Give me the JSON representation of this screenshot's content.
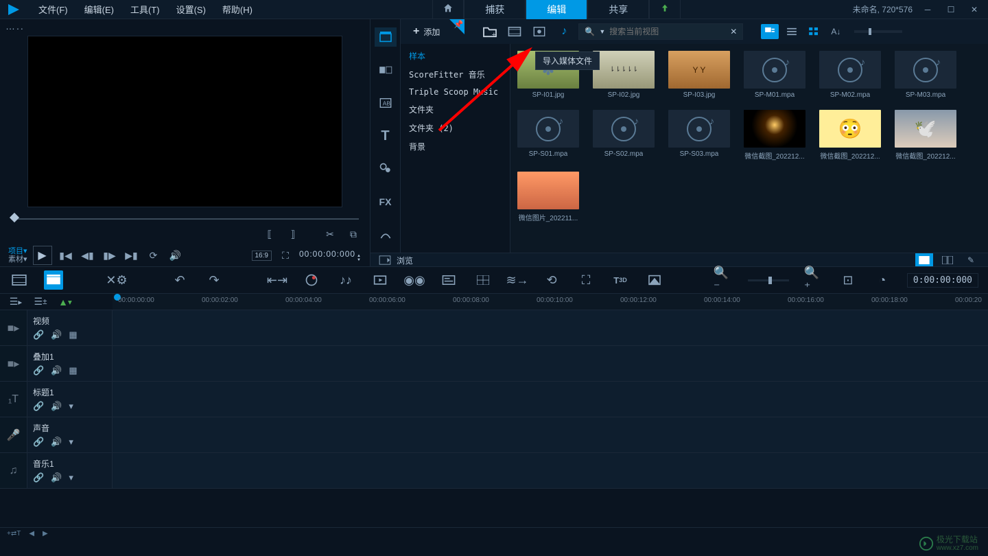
{
  "menubar": {
    "items": [
      "文件(F)",
      "编辑(E)",
      "工具(T)",
      "设置(S)",
      "帮助(H)"
    ],
    "center": {
      "capture": "捕获",
      "edit": "编辑",
      "share": "共享"
    },
    "status": "未命名, 720*576"
  },
  "preview": {
    "header": "…..",
    "project_label": "项目▾",
    "material_label": "素材▾",
    "aspect": "16:9",
    "timecode": "00:00:00:000"
  },
  "library": {
    "add_label": "添加",
    "search_placeholder": "搜索当前视图",
    "tooltip": "导入媒体文件",
    "folders": [
      "样本",
      "ScoreFitter 音乐",
      "Triple Scoop Music",
      "文件夹",
      "文件夹 (2)",
      "背景"
    ],
    "browse": "浏览",
    "thumbs": [
      {
        "name": "SP-I01.jpg",
        "type": "img1"
      },
      {
        "name": "SP-I02.jpg",
        "type": "img2"
      },
      {
        "name": "SP-I03.jpg",
        "type": "img3"
      },
      {
        "name": "SP-M01.mpa",
        "type": "audio"
      },
      {
        "name": "SP-M02.mpa",
        "type": "audio"
      },
      {
        "name": "SP-M03.mpa",
        "type": "audio"
      },
      {
        "name": "SP-S01.mpa",
        "type": "audio"
      },
      {
        "name": "SP-S02.mpa",
        "type": "audio"
      },
      {
        "name": "SP-S03.mpa",
        "type": "audio"
      },
      {
        "name": "微信截图_202212...",
        "type": "candle"
      },
      {
        "name": "微信截图_202212...",
        "type": "cartoon"
      },
      {
        "name": "微信截图_202212...",
        "type": "dove"
      },
      {
        "name": "微信图片_202211...",
        "type": "sunset"
      }
    ]
  },
  "timeline": {
    "timecode": "0:00:00:000",
    "ruler": [
      "00:00:00:00",
      "00:00:02:00",
      "00:00:04:00",
      "00:00:06:00",
      "00:00:08:00",
      "00:00:10:00",
      "00:00:12:00",
      "00:00:14:00",
      "00:00:16:00",
      "00:00:18:00",
      "00:00:20"
    ],
    "tracks": [
      {
        "name": "视频",
        "icon": "video",
        "extra": true
      },
      {
        "name": "叠加1",
        "icon": "video",
        "extra": true
      },
      {
        "name": "标题1",
        "icon": "title",
        "extra": false
      },
      {
        "name": "声音",
        "icon": "mic",
        "extra": false
      },
      {
        "name": "音乐1",
        "icon": "music",
        "extra": false
      }
    ],
    "scroll_label": "+⇄T"
  },
  "watermark": {
    "brand": "极光下载站",
    "url": "www.xz7.com"
  }
}
